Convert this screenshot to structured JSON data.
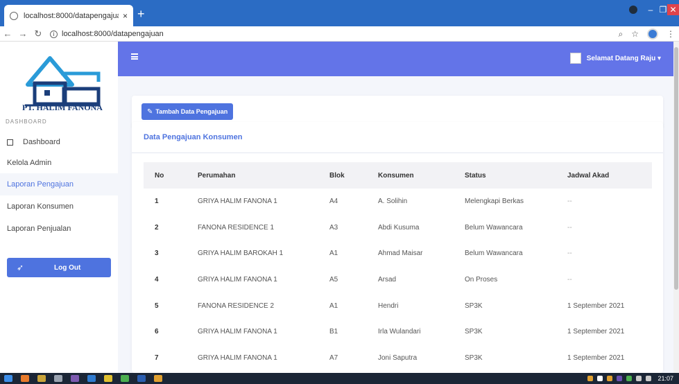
{
  "browser": {
    "tab_title": "localhost:8000/datapengajuan",
    "tab_close": "×",
    "new_tab": "+",
    "url": "localhost:8000/datapengajuan"
  },
  "sidebar": {
    "logo_text": "PT. HALIM FANONA",
    "heading": "DASHBOARD",
    "items": [
      {
        "label": "Dashboard"
      },
      {
        "label": "Kelola Admin"
      },
      {
        "label": "Laporan Pengajuan"
      },
      {
        "label": "Laporan Konsumen"
      },
      {
        "label": "Laporan Penjualan"
      }
    ],
    "logout_label": "Log Out"
  },
  "topbar": {
    "user_greeting": "Selamat Datang Raju ▾"
  },
  "actions": {
    "add_label": "Tambah Data Pengajuan"
  },
  "table_card": {
    "title": "Data Pengajuan Konsumen",
    "columns": [
      "No",
      "Perumahan",
      "Blok",
      "Konsumen",
      "Status",
      "Jadwal Akad"
    ],
    "rows": [
      [
        "1",
        "GRIYA HALIM FANONA 1",
        "A4",
        "A. Solihin",
        "Melengkapi Berkas",
        "--"
      ],
      [
        "2",
        "FANONA RESIDENCE 1",
        "A3",
        "Abdi Kusuma",
        "Belum Wawancara",
        "--"
      ],
      [
        "3",
        "GRIYA HALIM BAROKAH 1",
        "A1",
        "Ahmad Maisar",
        "Belum Wawancara",
        "--"
      ],
      [
        "4",
        "GRIYA HALIM FANONA 1",
        "A5",
        "Arsad",
        "On Proses",
        "--"
      ],
      [
        "5",
        "FANONA RESIDENCE 2",
        "A1",
        "Hendri",
        "SP3K",
        "1 September 2021"
      ],
      [
        "6",
        "GRIYA HALIM FANONA 1",
        "B1",
        "Irla Wulandari",
        "SP3K",
        "1 September 2021"
      ],
      [
        "7",
        "GRIYA HALIM FANONA 1",
        "A7",
        "Joni Saputra",
        "SP3K",
        "1 September 2021"
      ]
    ]
  },
  "taskbar": {
    "time": "21:07"
  },
  "colors": {
    "accent": "#4e73df",
    "topbar": "#6374e8",
    "browser_bar": "#2b6cc4"
  }
}
